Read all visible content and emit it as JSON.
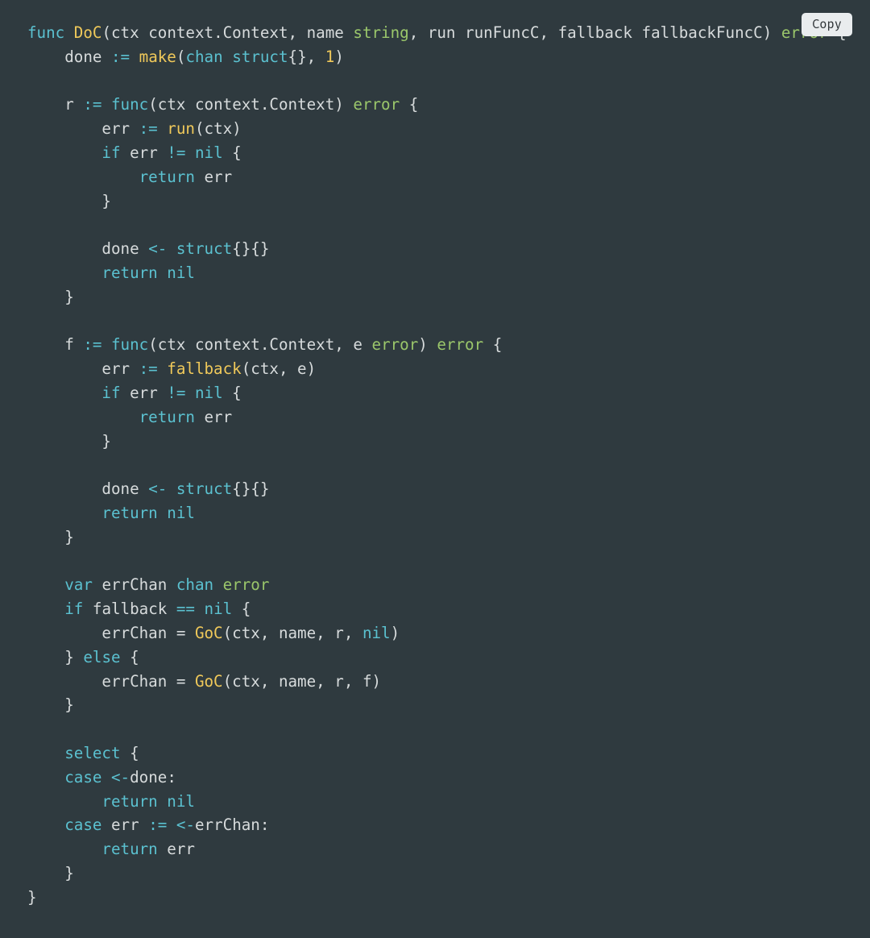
{
  "copy_label": "Copy",
  "tokens": {
    "kw_func": "func",
    "fn_DoC": "DoC",
    "p_open": "(",
    "id_ctx": "ctx",
    "sp": " ",
    "id_context_Context": "context.Context",
    "comma": ", ",
    "id_name": "name",
    "ty_string": "string",
    "id_run": "run",
    "id_runFuncC": "runFuncC",
    "id_fallback": "fallback",
    "id_fallbackFuncC": "fallbackFuncC",
    "p_close": ")",
    "ty_error": "error",
    "brace_open": " {",
    "brace_close": "}",
    "id_done": "done",
    "op_decl": " := ",
    "fn_make": "make",
    "kw_chan": "chan",
    "kw_struct": "struct",
    "braces_empty": "{}",
    "lit_1": "1",
    "id_r": "r",
    "id_err": "err",
    "fn_run": "run",
    "kw_if": "if",
    "op_neq": " != ",
    "kw_nil": "nil",
    "kw_return": "return",
    "op_send": " <- ",
    "braces_empty2": "{}{}",
    "id_f": "f",
    "id_e": "e",
    "fn_fallback": "fallback",
    "kw_var": "var",
    "id_errChan": "errChan",
    "op_eq2": " == ",
    "op_assign": " = ",
    "fn_GoC": "GoC",
    "kw_else": "else",
    "kw_select": "select",
    "kw_case": "case",
    "op_recv": "<-",
    "colon": ":",
    "indent1": "    ",
    "indent2": "        ",
    "indent3": "            ",
    "sp2": "  "
  },
  "lines": [
    [
      [
        "c-kw",
        "kw_func"
      ],
      [
        "c-punc",
        "sp"
      ],
      [
        "c-name",
        "fn_DoC"
      ],
      [
        "c-punc",
        "p_open"
      ],
      [
        "c-punc",
        "id_ctx"
      ],
      [
        "c-punc",
        "sp"
      ],
      [
        "c-punc",
        "id_context_Context"
      ],
      [
        "c-punc",
        "comma"
      ],
      [
        "c-punc",
        "id_name"
      ],
      [
        "c-punc",
        "sp"
      ],
      [
        "c-type",
        "ty_string"
      ],
      [
        "c-punc",
        "comma"
      ],
      [
        "c-punc",
        "id_run"
      ],
      [
        "c-punc",
        "sp"
      ],
      [
        "c-punc",
        "id_runFuncC"
      ],
      [
        "c-punc",
        "comma"
      ],
      [
        "c-punc",
        "id_fallback"
      ],
      [
        "c-punc",
        "sp"
      ],
      [
        "c-punc",
        "id_fallbackFuncC"
      ],
      [
        "c-punc",
        "p_close"
      ],
      [
        "c-punc",
        "sp"
      ],
      [
        "c-type",
        "ty_error"
      ],
      [
        "c-punc",
        "brace_open"
      ]
    ],
    [
      [
        "c-punc",
        "indent1"
      ],
      [
        "c-punc",
        "id_done"
      ],
      [
        "c-kw",
        "op_decl"
      ],
      [
        "c-name",
        "fn_make"
      ],
      [
        "c-punc",
        "p_open"
      ],
      [
        "c-kw",
        "kw_chan"
      ],
      [
        "c-punc",
        "sp"
      ],
      [
        "c-kw",
        "kw_struct"
      ],
      [
        "c-punc",
        "braces_empty"
      ],
      [
        "c-punc",
        "comma"
      ],
      [
        "c-lit",
        "lit_1"
      ],
      [
        "c-punc",
        "p_close"
      ]
    ],
    [],
    [
      [
        "c-punc",
        "indent1"
      ],
      [
        "c-punc",
        "id_r"
      ],
      [
        "c-kw",
        "op_decl"
      ],
      [
        "c-kw",
        "kw_func"
      ],
      [
        "c-punc",
        "p_open"
      ],
      [
        "c-punc",
        "id_ctx"
      ],
      [
        "c-punc",
        "sp"
      ],
      [
        "c-punc",
        "id_context_Context"
      ],
      [
        "c-punc",
        "p_close"
      ],
      [
        "c-punc",
        "sp"
      ],
      [
        "c-type",
        "ty_error"
      ],
      [
        "c-punc",
        "brace_open"
      ]
    ],
    [
      [
        "c-punc",
        "indent2"
      ],
      [
        "c-punc",
        "id_err"
      ],
      [
        "c-kw",
        "op_decl"
      ],
      [
        "c-name",
        "fn_run"
      ],
      [
        "c-punc",
        "p_open"
      ],
      [
        "c-punc",
        "id_ctx"
      ],
      [
        "c-punc",
        "p_close"
      ]
    ],
    [
      [
        "c-punc",
        "indent2"
      ],
      [
        "c-kw",
        "kw_if"
      ],
      [
        "c-punc",
        "sp"
      ],
      [
        "c-punc",
        "id_err"
      ],
      [
        "c-kw",
        "op_neq"
      ],
      [
        "c-kw",
        "kw_nil"
      ],
      [
        "c-punc",
        "brace_open"
      ]
    ],
    [
      [
        "c-punc",
        "indent3"
      ],
      [
        "c-kw",
        "kw_return"
      ],
      [
        "c-punc",
        "sp"
      ],
      [
        "c-punc",
        "id_err"
      ]
    ],
    [
      [
        "c-punc",
        "indent2"
      ],
      [
        "c-punc",
        "brace_close"
      ]
    ],
    [],
    [
      [
        "c-punc",
        "indent2"
      ],
      [
        "c-punc",
        "id_done"
      ],
      [
        "c-kw",
        "op_send"
      ],
      [
        "c-kw",
        "kw_struct"
      ],
      [
        "c-punc",
        "braces_empty2"
      ]
    ],
    [
      [
        "c-punc",
        "indent2"
      ],
      [
        "c-kw",
        "kw_return"
      ],
      [
        "c-punc",
        "sp"
      ],
      [
        "c-kw",
        "kw_nil"
      ]
    ],
    [
      [
        "c-punc",
        "indent1"
      ],
      [
        "c-punc",
        "brace_close"
      ]
    ],
    [],
    [
      [
        "c-punc",
        "indent1"
      ],
      [
        "c-punc",
        "id_f"
      ],
      [
        "c-kw",
        "op_decl"
      ],
      [
        "c-kw",
        "kw_func"
      ],
      [
        "c-punc",
        "p_open"
      ],
      [
        "c-punc",
        "id_ctx"
      ],
      [
        "c-punc",
        "sp"
      ],
      [
        "c-punc",
        "id_context_Context"
      ],
      [
        "c-punc",
        "comma"
      ],
      [
        "c-punc",
        "id_e"
      ],
      [
        "c-punc",
        "sp"
      ],
      [
        "c-type",
        "ty_error"
      ],
      [
        "c-punc",
        "p_close"
      ],
      [
        "c-punc",
        "sp"
      ],
      [
        "c-type",
        "ty_error"
      ],
      [
        "c-punc",
        "brace_open"
      ]
    ],
    [
      [
        "c-punc",
        "indent2"
      ],
      [
        "c-punc",
        "id_err"
      ],
      [
        "c-kw",
        "op_decl"
      ],
      [
        "c-name",
        "fn_fallback"
      ],
      [
        "c-punc",
        "p_open"
      ],
      [
        "c-punc",
        "id_ctx"
      ],
      [
        "c-punc",
        "comma"
      ],
      [
        "c-punc",
        "id_e"
      ],
      [
        "c-punc",
        "p_close"
      ]
    ],
    [
      [
        "c-punc",
        "indent2"
      ],
      [
        "c-kw",
        "kw_if"
      ],
      [
        "c-punc",
        "sp"
      ],
      [
        "c-punc",
        "id_err"
      ],
      [
        "c-kw",
        "op_neq"
      ],
      [
        "c-kw",
        "kw_nil"
      ],
      [
        "c-punc",
        "brace_open"
      ]
    ],
    [
      [
        "c-punc",
        "indent3"
      ],
      [
        "c-kw",
        "kw_return"
      ],
      [
        "c-punc",
        "sp"
      ],
      [
        "c-punc",
        "id_err"
      ]
    ],
    [
      [
        "c-punc",
        "indent2"
      ],
      [
        "c-punc",
        "brace_close"
      ]
    ],
    [],
    [
      [
        "c-punc",
        "indent2"
      ],
      [
        "c-punc",
        "id_done"
      ],
      [
        "c-kw",
        "op_send"
      ],
      [
        "c-kw",
        "kw_struct"
      ],
      [
        "c-punc",
        "braces_empty2"
      ]
    ],
    [
      [
        "c-punc",
        "indent2"
      ],
      [
        "c-kw",
        "kw_return"
      ],
      [
        "c-punc",
        "sp"
      ],
      [
        "c-kw",
        "kw_nil"
      ]
    ],
    [
      [
        "c-punc",
        "indent1"
      ],
      [
        "c-punc",
        "brace_close"
      ]
    ],
    [],
    [
      [
        "c-punc",
        "indent1"
      ],
      [
        "c-kw",
        "kw_var"
      ],
      [
        "c-punc",
        "sp"
      ],
      [
        "c-punc",
        "id_errChan"
      ],
      [
        "c-punc",
        "sp"
      ],
      [
        "c-kw",
        "kw_chan"
      ],
      [
        "c-punc",
        "sp"
      ],
      [
        "c-type",
        "ty_error"
      ]
    ],
    [
      [
        "c-punc",
        "indent1"
      ],
      [
        "c-kw",
        "kw_if"
      ],
      [
        "c-punc",
        "sp"
      ],
      [
        "c-punc",
        "id_fallback"
      ],
      [
        "c-kw",
        "op_eq2"
      ],
      [
        "c-kw",
        "kw_nil"
      ],
      [
        "c-punc",
        "brace_open"
      ]
    ],
    [
      [
        "c-punc",
        "indent2"
      ],
      [
        "c-punc",
        "id_errChan"
      ],
      [
        "c-punc",
        "op_assign"
      ],
      [
        "c-name",
        "fn_GoC"
      ],
      [
        "c-punc",
        "p_open"
      ],
      [
        "c-punc",
        "id_ctx"
      ],
      [
        "c-punc",
        "comma"
      ],
      [
        "c-punc",
        "id_name"
      ],
      [
        "c-punc",
        "comma"
      ],
      [
        "c-punc",
        "id_r"
      ],
      [
        "c-punc",
        "comma"
      ],
      [
        "c-kw",
        "kw_nil"
      ],
      [
        "c-punc",
        "p_close"
      ]
    ],
    [
      [
        "c-punc",
        "indent1"
      ],
      [
        "c-punc",
        "brace_close"
      ],
      [
        "c-punc",
        "sp"
      ],
      [
        "c-kw",
        "kw_else"
      ],
      [
        "c-punc",
        "brace_open"
      ]
    ],
    [
      [
        "c-punc",
        "indent2"
      ],
      [
        "c-punc",
        "id_errChan"
      ],
      [
        "c-punc",
        "op_assign"
      ],
      [
        "c-name",
        "fn_GoC"
      ],
      [
        "c-punc",
        "p_open"
      ],
      [
        "c-punc",
        "id_ctx"
      ],
      [
        "c-punc",
        "comma"
      ],
      [
        "c-punc",
        "id_name"
      ],
      [
        "c-punc",
        "comma"
      ],
      [
        "c-punc",
        "id_r"
      ],
      [
        "c-punc",
        "comma"
      ],
      [
        "c-punc",
        "id_f"
      ],
      [
        "c-punc",
        "p_close"
      ]
    ],
    [
      [
        "c-punc",
        "indent1"
      ],
      [
        "c-punc",
        "brace_close"
      ]
    ],
    [],
    [
      [
        "c-punc",
        "indent1"
      ],
      [
        "c-kw",
        "kw_select"
      ],
      [
        "c-punc",
        "brace_open"
      ]
    ],
    [
      [
        "c-punc",
        "indent1"
      ],
      [
        "c-kw",
        "kw_case"
      ],
      [
        "c-punc",
        "sp"
      ],
      [
        "c-kw",
        "op_recv"
      ],
      [
        "c-punc",
        "id_done"
      ],
      [
        "c-punc",
        "colon"
      ]
    ],
    [
      [
        "c-punc",
        "indent2"
      ],
      [
        "c-kw",
        "kw_return"
      ],
      [
        "c-punc",
        "sp"
      ],
      [
        "c-kw",
        "kw_nil"
      ]
    ],
    [
      [
        "c-punc",
        "indent1"
      ],
      [
        "c-kw",
        "kw_case"
      ],
      [
        "c-punc",
        "sp"
      ],
      [
        "c-punc",
        "id_err"
      ],
      [
        "c-kw",
        "op_decl"
      ],
      [
        "c-kw",
        "op_recv"
      ],
      [
        "c-punc",
        "id_errChan"
      ],
      [
        "c-punc",
        "colon"
      ]
    ],
    [
      [
        "c-punc",
        "indent2"
      ],
      [
        "c-kw",
        "kw_return"
      ],
      [
        "c-punc",
        "sp"
      ],
      [
        "c-punc",
        "id_err"
      ]
    ],
    [
      [
        "c-punc",
        "indent1"
      ],
      [
        "c-punc",
        "brace_close"
      ]
    ],
    [
      [
        "c-punc",
        "brace_close"
      ]
    ]
  ]
}
